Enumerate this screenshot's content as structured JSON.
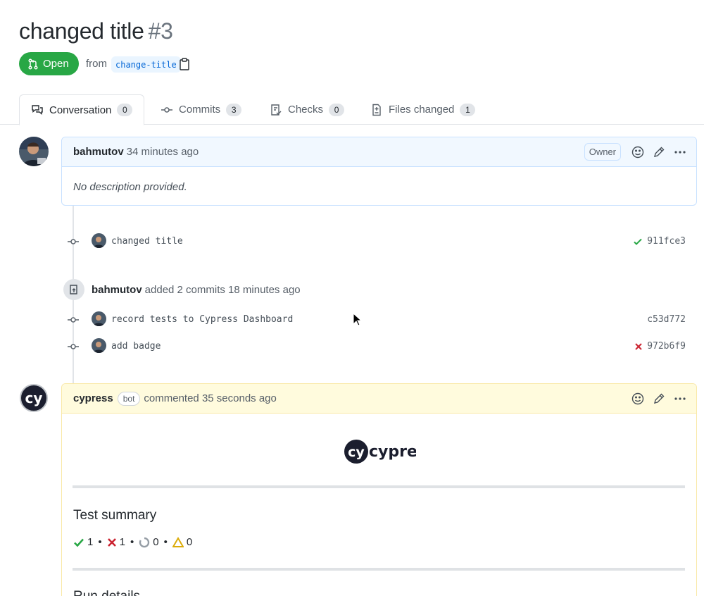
{
  "pr": {
    "title": "changed title",
    "number": "#3",
    "state": "Open",
    "from_label": "from",
    "branch": "change-title"
  },
  "tabs": [
    {
      "label": "Conversation",
      "count": "0",
      "icon": "conversation-icon"
    },
    {
      "label": "Commits",
      "count": "3",
      "icon": "commit-icon"
    },
    {
      "label": "Checks",
      "count": "0",
      "icon": "checks-icon"
    },
    {
      "label": "Files changed",
      "count": "1",
      "icon": "file-diff-icon"
    }
  ],
  "first_comment": {
    "author": "bahmutov",
    "time": "34 minutes ago",
    "role": "Owner",
    "body": "No description provided."
  },
  "commits_group_1": [
    {
      "message": "changed title",
      "sha": "911fce3",
      "status": "success"
    }
  ],
  "event": {
    "actor": "bahmutov",
    "text": "added 2 commits 18 minutes ago"
  },
  "commits_group_2": [
    {
      "message": "record tests to Cypress Dashboard",
      "sha": "c53d772",
      "status": "none"
    },
    {
      "message": "add badge",
      "sha": "972b6f9",
      "status": "failure"
    }
  ],
  "bot_comment": {
    "author": "cypress",
    "badge": "bot",
    "time": "commented 35 seconds ago",
    "logo_text": "cypress",
    "summary_heading": "Test summary",
    "summary": {
      "passed": "1",
      "failed": "1",
      "pending": "0",
      "skipped": "0"
    },
    "next_heading": "Run details"
  },
  "colors": {
    "open_green": "#28a745",
    "link_blue": "#0366d6",
    "fail_red": "#cb2431",
    "warn_yellow": "#dbab09"
  }
}
